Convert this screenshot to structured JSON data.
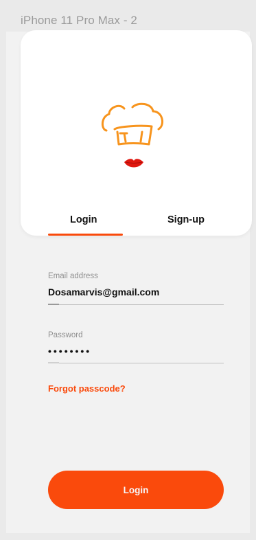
{
  "frame": {
    "label": "iPhone 11 Pro Max - 2"
  },
  "logo": {
    "icon": "chef-hat-lips-logo",
    "hat_color": "#f7941d",
    "lips_color": "#e0170f"
  },
  "tabs": [
    {
      "label": "Login",
      "active": true
    },
    {
      "label": "Sign-up",
      "active": false
    }
  ],
  "form": {
    "email_label": "Email address",
    "email_value": "Dosamarvis@gmail.com",
    "password_label": "Password",
    "password_value": "********",
    "forgot_label": "Forgot passcode?"
  },
  "login_button": {
    "label": "Login"
  },
  "colors": {
    "accent": "#fa4a0c",
    "background": "#f2f2f2",
    "card": "#ffffff"
  }
}
